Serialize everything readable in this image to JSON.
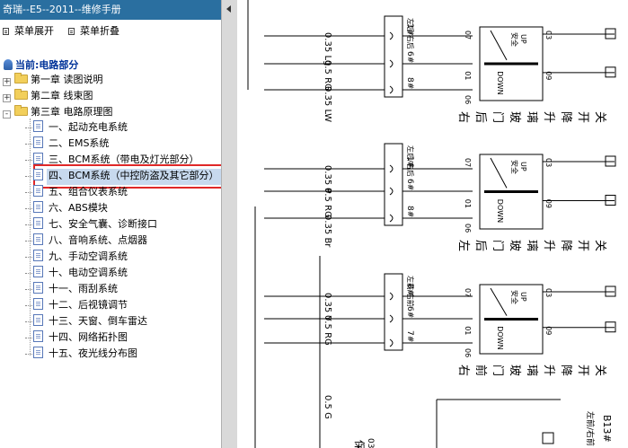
{
  "window": {
    "title": "奇瑞--E5--2011--维修手册"
  },
  "toolbar": {
    "expand": "菜单展开",
    "collapse": "菜单折叠"
  },
  "tree": {
    "current_label": "当前:电路部分",
    "chapters": [
      {
        "label": "第一章 读图说明",
        "expander": "+"
      },
      {
        "label": "第二章 线束图",
        "expander": "+"
      },
      {
        "label": "第三章 电路原理图",
        "expander": "-"
      }
    ],
    "items": [
      "一、起动充电系统",
      "二、EMS系统",
      "三、BCM系统（带电及灯光部分）",
      "四、BCM系统（中控防盗及其它部分）",
      "五、组合仪表系统",
      "六、ABS模块",
      "七、安全气囊、诊断接口",
      "八、音响系统、点烟器",
      "九、手动空调系统",
      "十、电动空调系统",
      "十一、雨刮系统",
      "十二、后视镜调节",
      "十三、天窗、倒车雷达",
      "十四、网络拓扑图",
      "十五、夜光线分布图"
    ],
    "selected_index": 3
  },
  "diagram": {
    "switches": [
      {
        "name_chars": [
          "右",
          "后",
          "门",
          "玻",
          "璃",
          "升",
          "降",
          "开",
          "关"
        ],
        "wires": [
          "0.35 Lg",
          "0.5 RG",
          "0.35 LW"
        ],
        "pins": [
          "1#",
          "6#",
          "8#"
        ],
        "conn_label": "左后/右后"
      },
      {
        "name_chars": [
          "左",
          "后",
          "门",
          "玻",
          "璃",
          "升",
          "降",
          "开",
          "关"
        ],
        "wires": [
          "0.35 P",
          "0.5 RG",
          "0.35 Br"
        ],
        "pins": [
          "1#",
          "6#",
          "8#"
        ],
        "conn_label": "左后/右后"
      },
      {
        "name_chars": [
          "右",
          "前",
          "门",
          "玻",
          "璃",
          "升",
          "降",
          "开",
          "关"
        ],
        "wires": [
          "0.35 Y",
          "0.5 RG"
        ],
        "pins": [
          "8#",
          "6#",
          "7#"
        ],
        "conn_label": "左前/右前"
      }
    ],
    "switch_pins": [
      "07",
      "01",
      "06",
      "03",
      "09"
    ],
    "switch_text": {
      "up": "UP",
      "down": "DOWN",
      "mark": "安全"
    },
    "bottom_wire": "0.5 G",
    "bottom_conn": "B13#",
    "bottom_conn_label": "左前/右前",
    "bottom_fuse": "保",
    "bottom_digit": "03"
  }
}
